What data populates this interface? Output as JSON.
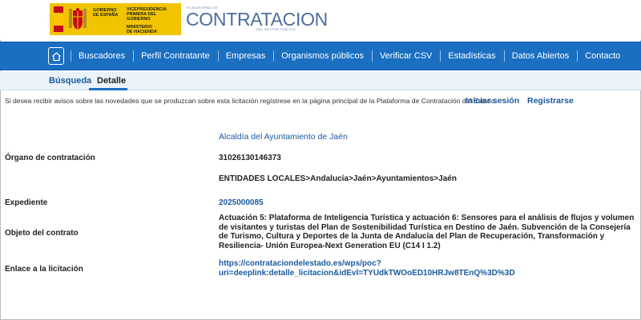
{
  "header": {
    "gov_lines": [
      "VICEPRESIDENCIA",
      "PRIMERA DEL GOBIERNO",
      "MINISTERIO",
      "DE HACIENDA"
    ],
    "gov_name": [
      "GOBIERNO",
      "DE ESPAÑA"
    ],
    "brand_small": "PLATAFORMA DE",
    "brand_main": "CONTRATACION",
    "brand_sub": "DEL SECTOR PÚBLICO"
  },
  "nav": {
    "items": [
      "Buscadores",
      "Perfil Contratante",
      "Empresas",
      "Organismos públicos",
      "Verificar CSV",
      "Estadísticas",
      "Datos Abiertos",
      "Contacto"
    ]
  },
  "tabs": {
    "busqueda": "Búsqueda",
    "detalle": "Detalle"
  },
  "notice": {
    "text": "Si desea recibir avisos sobre las novedades que se produzcan sobre esta licitación regístrese en la página principal de la Plataforma de Contratación del Estado.",
    "login": "Iniciar sesión",
    "register": "Registrarse"
  },
  "detail": {
    "org_name": "Alcaldía del Ayuntamiento de Jaén",
    "organo_label": "Órgano de contratación",
    "organo_code": "31026130146373",
    "organo_path": "ENTIDADES LOCALES>Andalucía>Jaén>Ayuntamientos>Jaén",
    "expediente_label": "Expediente",
    "expediente_value": "2025000085",
    "objeto_label": "Objeto del contrato",
    "objeto_value": "Actuación 5: Plataforma de Inteligencia Turística y actuación 6: Sensores para el análisis de flujos y volumen de visitantes y turistas del Plan de Sostenibilidad Turística en Destino de Jaén. Subvención de la Consejería de Turismo, Cultura y Deportes de la Junta de Andalucía del Plan de Recuperación, Transformación y Resiliencia- Unión Europea-Next Generation EU (C14 I 1.2)",
    "enlace_label": "Enlace a la licitación",
    "enlace_line1": "https://contrataciondelestado.es/wps/poc?",
    "enlace_line2": "uri=deeplink:detalle_licitacion&idEvl=TYUdkTWOoED10HRJw8TEnQ%3D%3D"
  }
}
